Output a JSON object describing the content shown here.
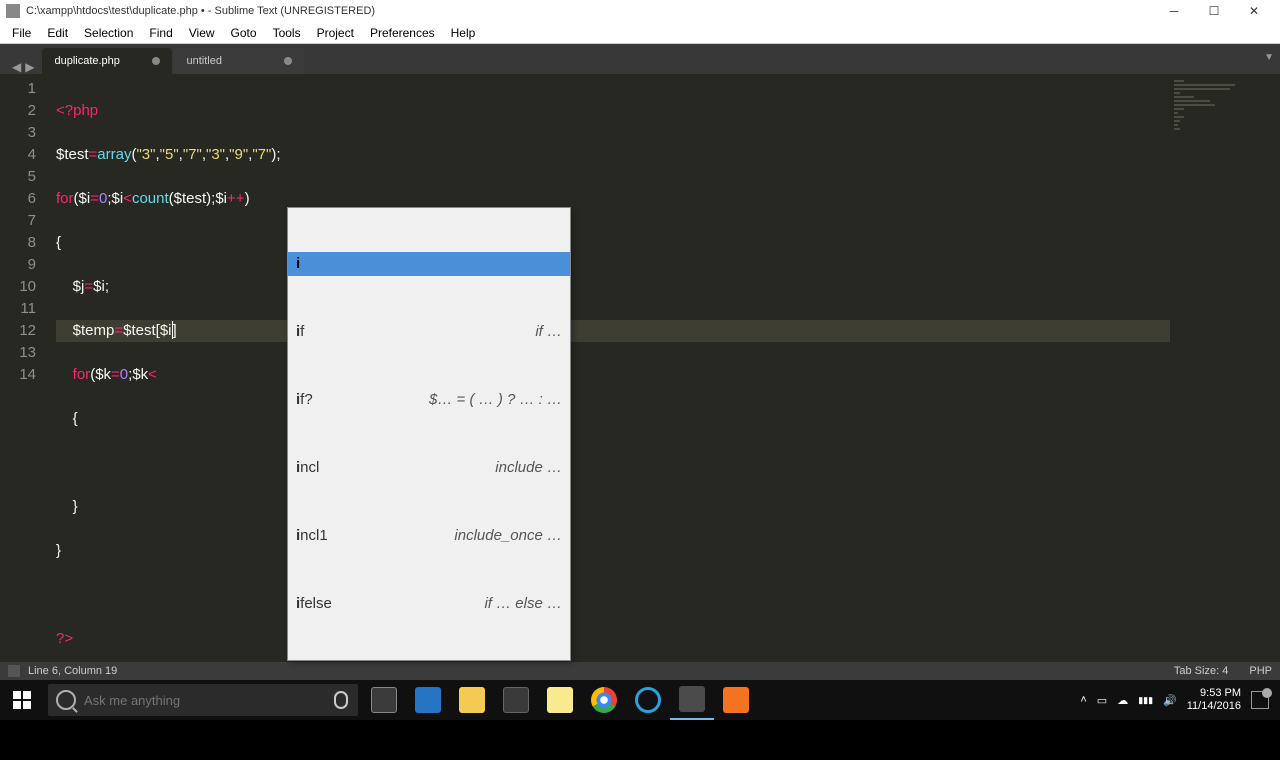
{
  "window": {
    "title": "C:\\xampp\\htdocs\\test\\duplicate.php • - Sublime Text (UNREGISTERED)"
  },
  "menu": [
    "File",
    "Edit",
    "Selection",
    "Find",
    "View",
    "Goto",
    "Tools",
    "Project",
    "Preferences",
    "Help"
  ],
  "tabs": [
    {
      "label": "duplicate.php",
      "dirty": true,
      "active": true
    },
    {
      "label": "untitled",
      "dirty": true,
      "active": false
    }
  ],
  "gutter": [
    "1",
    "2",
    "3",
    "4",
    "5",
    "6",
    "7",
    "8",
    "9",
    "10",
    "11",
    "12",
    "13",
    "14"
  ],
  "code": {
    "l1_open": "<?php",
    "l2_var": "$test",
    "l2_eq": "=",
    "l2_fn": "array",
    "l2_args_open": "(",
    "l2_s1": "\"3\"",
    "l2_s2": "\"5\"",
    "l2_s3": "\"7\"",
    "l2_s4": "\"3\"",
    "l2_s5": "\"9\"",
    "l2_s6": "\"7\"",
    "l2_args_close": ");",
    "l3_for": "for",
    "l3_a": "(",
    "l3_var_i": "$i",
    "l3_eq": "=",
    "l3_zero": "0",
    "l3_semi1": ";",
    "l3_var_i2": "$i",
    "l3_lt": "<",
    "l3_count": "count",
    "l3_p1": "(",
    "l3_test": "$test",
    "l3_p2": ");",
    "l3_var_i3": "$i",
    "l3_inc": "++",
    "l3_close": ")",
    "l4_brace": "{",
    "l5_j": "    $j",
    "l5_eq": "=",
    "l5_i": "$i",
    "l5_semi": ";",
    "l6_temp": "    $temp",
    "l6_eq": "=",
    "l6_test": "$test",
    "l6_br1": "[",
    "l6_i": "$i",
    "l6_br2": "]",
    "l7_for": "    for",
    "l7_a": "(",
    "l7_k": "$k",
    "l7_eq": "=",
    "l7_zero": "0",
    "l7_semi": ";",
    "l7_k2": "$k",
    "l7_lt": "<",
    "l8_brace": "    {",
    "l9": "",
    "l10_brace": "    }",
    "l11_brace": "}",
    "l12": "",
    "l13_close": "?>"
  },
  "autocomplete": [
    {
      "trigger": "i",
      "hint": "",
      "selected": true
    },
    {
      "trigger": "if",
      "hint": "if …",
      "selected": false
    },
    {
      "trigger": "if?",
      "hint": "$… = ( … ) ? … : …",
      "selected": false
    },
    {
      "trigger": "incl",
      "hint": "include …",
      "selected": false
    },
    {
      "trigger": "incl1",
      "hint": "include_once …",
      "selected": false
    },
    {
      "trigger": "ifelse",
      "hint": "if … else …",
      "selected": false
    }
  ],
  "statusbar": {
    "left": "Line 6, Column 19",
    "tabsize": "Tab Size: 4",
    "syntax": "PHP"
  },
  "taskbar": {
    "search_placeholder": "Ask me anything",
    "time": "9:53 PM",
    "date": "11/14/2016"
  }
}
